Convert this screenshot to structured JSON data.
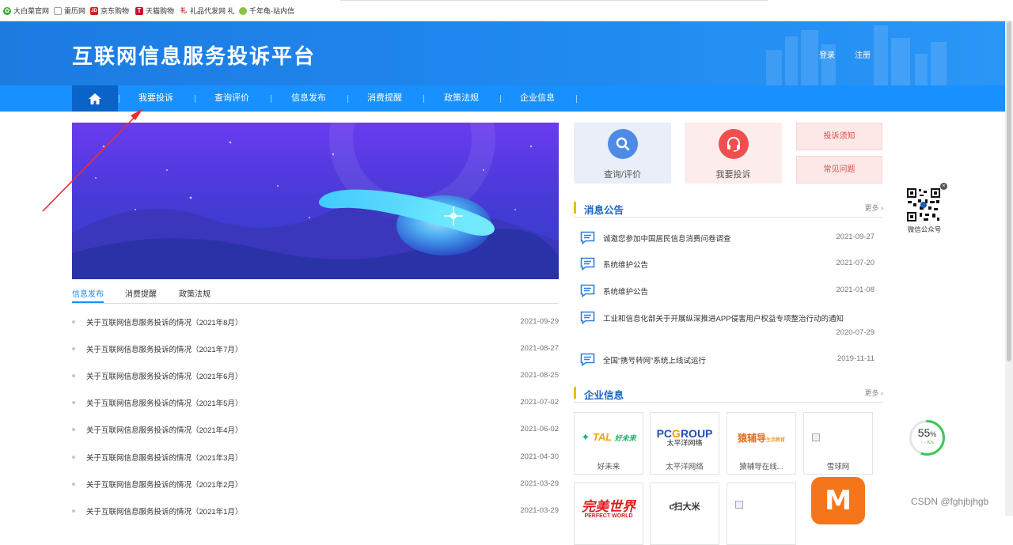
{
  "bookmarks": [
    {
      "label": "大白菜官网",
      "icon": "leaf-icon",
      "color": "#3aa83a"
    },
    {
      "label": "雷历网",
      "icon": "page-icon",
      "color": "#9aa0a6"
    },
    {
      "label": "京东购物",
      "icon": "jd-icon",
      "color": "#d71b1b"
    },
    {
      "label": "天猫购物",
      "icon": "tmall-icon",
      "color": "#c8102e"
    },
    {
      "label": "礼品代发网 礼",
      "icon": "gift-icon",
      "color": "#d03a3a"
    },
    {
      "label": "千年龟-站内信",
      "icon": "turtle-icon",
      "color": "#8bc34a"
    }
  ],
  "header": {
    "title": "互联网信息服务投诉平台",
    "login": "登录",
    "register": "注册",
    "bg_color": "#1e86ee"
  },
  "nav": {
    "items": [
      "我要投诉",
      "查询评价",
      "信息发布",
      "消费提醒",
      "政策法规",
      "企业信息"
    ],
    "color": "#1890ff",
    "home_color": "#0a63c8"
  },
  "tabs": [
    "信息发布",
    "消费提醒",
    "政策法规"
  ],
  "news": [
    {
      "title": "关于互联网信息服务投诉的情况（2021年8月）",
      "date": "2021-09-29"
    },
    {
      "title": "关于互联网信息服务投诉的情况（2021年7月）",
      "date": "2021-08-27"
    },
    {
      "title": "关于互联网信息服务投诉的情况（2021年6月）",
      "date": "2021-08-25"
    },
    {
      "title": "关于互联网信息服务投诉的情况（2021年5月）",
      "date": "2021-07-02"
    },
    {
      "title": "关于互联网信息服务投诉的情况（2021年4月）",
      "date": "2021-06-02"
    },
    {
      "title": "关于互联网信息服务投诉的情况（2021年3月）",
      "date": "2021-04-30"
    },
    {
      "title": "关于互联网信息服务投诉的情况（2021年2月）",
      "date": "2021-03-29"
    },
    {
      "title": "关于互联网信息服务投诉的情况（2021年1月）",
      "date": "2021-03-29"
    }
  ],
  "quick": {
    "query_label": "查询/评价",
    "complain_label": "我要投诉",
    "notice_label": "投诉须知",
    "faq_label": "常见问题"
  },
  "announcements": {
    "title": "消息公告",
    "more": "更多",
    "items": [
      {
        "title": "诚邀您参加中国居民信息消费问卷调查",
        "date": "2021-09-27"
      },
      {
        "title": "系统维护公告",
        "date": "2021-07-20"
      },
      {
        "title": "系统维护公告",
        "date": "2021-01-08"
      },
      {
        "title": "工业和信息化部关于开展纵深推进APP侵害用户权益专项整治行动的通知",
        "date": "2020-07-29"
      },
      {
        "title": "全国“携号转网”系统上线试运行",
        "date": "2019-11-11"
      }
    ]
  },
  "enterprise": {
    "title": "企业信息",
    "more": "更多",
    "items": [
      {
        "name": "好未来",
        "logo": "TAL 好未来"
      },
      {
        "name": "太平洋网络",
        "logo": "PCGROUP 太平洋网络"
      },
      {
        "name": "猿辅导在线...",
        "logo": "猿辅导 在线教育"
      },
      {
        "name": "雪球网",
        "logo": ""
      },
      {
        "name": "",
        "logo": "完美世界 PERFECT WORLD"
      },
      {
        "name": "",
        "logo": "扫大米"
      },
      {
        "name": "",
        "logo": ""
      },
      {
        "name": "",
        "logo": "M"
      }
    ]
  },
  "wechat_label": "微信公众号",
  "speed": {
    "value": "55",
    "unit": "%",
    "sub": "↑ - K/s",
    "fraction": 0.55
  },
  "watermark": "CSDN @fghjbjhgb"
}
